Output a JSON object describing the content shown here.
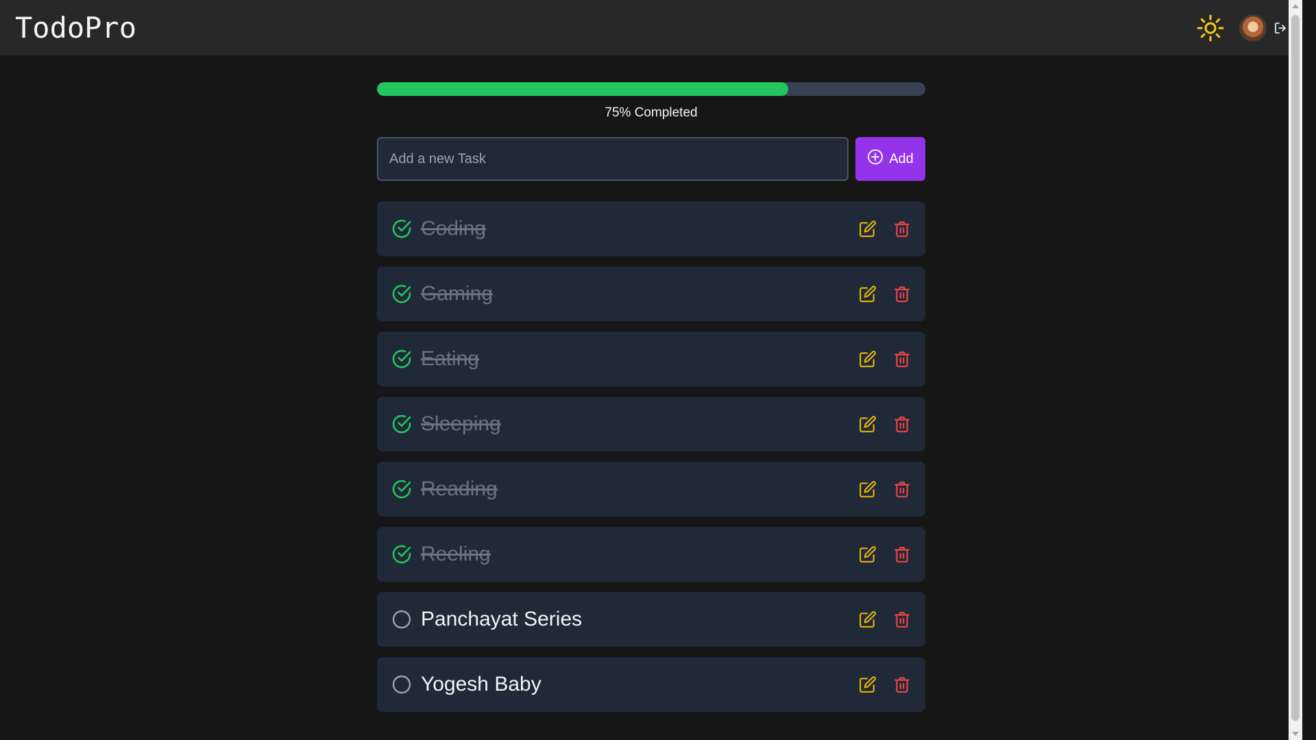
{
  "header": {
    "brand": "TodoPro",
    "theme_icon": "sun-icon",
    "avatar_icon": "avatar",
    "logout_icon": "logout-icon"
  },
  "progress": {
    "percent": 75,
    "label": "75% Completed",
    "color": "#22c55e"
  },
  "add_form": {
    "placeholder": "Add a new Task",
    "value": "",
    "button_label": "Add",
    "button_icon": "plus-circle-icon",
    "button_color": "#9333ea"
  },
  "tasks": [
    {
      "title": "Coding",
      "done": true
    },
    {
      "title": "Gaming",
      "done": true
    },
    {
      "title": "Eating",
      "done": true
    },
    {
      "title": "Sleeping",
      "done": true
    },
    {
      "title": "Reading",
      "done": true
    },
    {
      "title": "Reeling",
      "done": true
    },
    {
      "title": "Panchayat Series",
      "done": false
    },
    {
      "title": "Yogesh Baby",
      "done": false
    }
  ],
  "task_icons": {
    "done": "check-circle-icon",
    "pending": "circle-icon",
    "edit": "edit-icon",
    "delete": "trash-icon"
  },
  "colors": {
    "accent_green": "#22c55e",
    "edit_yellow": "#eab308",
    "delete_red": "#ef4444",
    "sun_yellow": "#facc15"
  }
}
